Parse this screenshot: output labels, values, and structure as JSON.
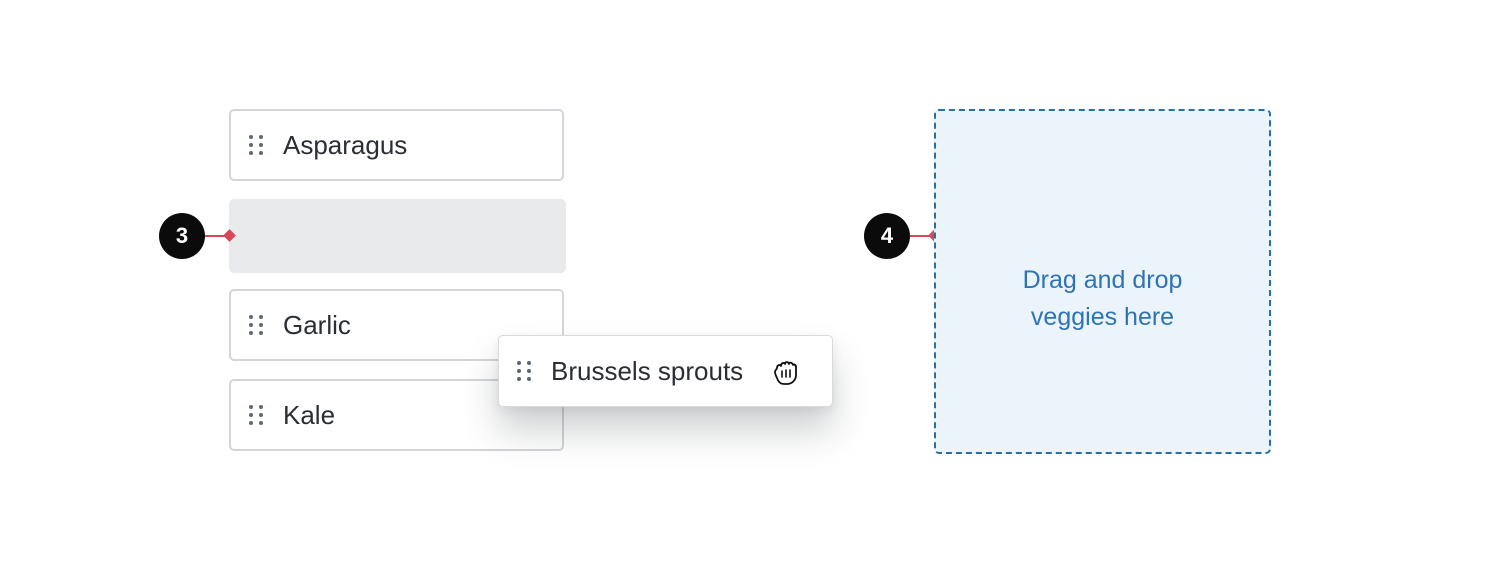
{
  "list": {
    "items": [
      {
        "label": "Asparagus"
      },
      {
        "label": "Garlic"
      },
      {
        "label": "Kale"
      }
    ]
  },
  "drag_item": {
    "label": "Brussels sprouts",
    "cursor_icon": "grab-hand-icon"
  },
  "dropzone": {
    "text": "Drag and drop veggies here"
  },
  "annotations": [
    {
      "number": "3",
      "target": "placeholder slot"
    },
    {
      "number": "4",
      "target": "drop zone"
    }
  ],
  "colors": {
    "marker_line": "#d7485a",
    "dropzone_border": "#2a6fa4",
    "dropzone_background": "#ebf3fb",
    "dropzone_text": "#2e74b5",
    "placeholder_background": "#e9eaeb"
  }
}
